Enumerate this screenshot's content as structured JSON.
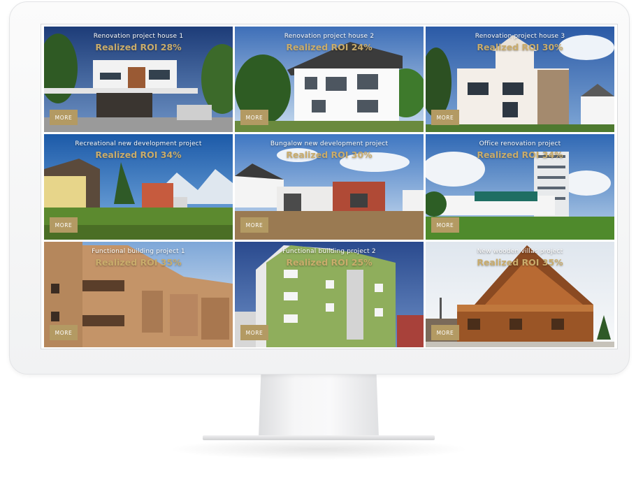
{
  "projects": [
    {
      "title": "Renovation project house 1",
      "roi": "Realized ROI 28%",
      "more": "MORE"
    },
    {
      "title": "Renovation project house 2",
      "roi": "Realized ROI 24%",
      "more": "MORE"
    },
    {
      "title": "Renovation project house 3",
      "roi": "Realized ROI 30%",
      "more": "MORE"
    },
    {
      "title": "Recreational new development project",
      "roi": "Realized ROI 34%",
      "more": "MORE"
    },
    {
      "title": "Bungalow new development project",
      "roi": "Realized ROI 30%",
      "more": "MORE"
    },
    {
      "title": "Office renovation project",
      "roi": "Realized ROI 34%",
      "more": "MORE"
    },
    {
      "title": "Functional building project 1",
      "roi": "Realized ROI 35%",
      "more": "MORE"
    },
    {
      "title": "Functional building project 2",
      "roi": "Realized ROI 25%",
      "more": "MORE"
    },
    {
      "title": "New wooden villas project",
      "roi": "Realized ROI 35%",
      "more": "MORE"
    }
  ],
  "colors": {
    "accent": "#b39a63",
    "roi_text": "#c9ac6b"
  }
}
